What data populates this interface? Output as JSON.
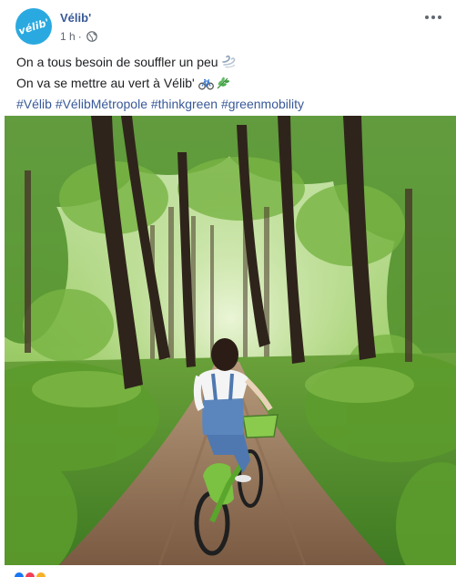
{
  "header": {
    "page_name": "Vélib'",
    "avatar_text": "vélib'",
    "time": "1 h",
    "separator": "·",
    "audience_icon": "globe-icon",
    "more_icon": "more-options-icon"
  },
  "post": {
    "line1": "On a tous besoin de souffler un peu",
    "line1_emoji": "dash-emoji",
    "line2": "On va se mettre au vert à Vélib'",
    "line2_emojis": [
      "bicycle-emoji",
      "herb-emoji"
    ],
    "hashtags": [
      "#Vélib",
      "#VélibMétropole",
      "#thinkgreen",
      "#greenmobility"
    ]
  },
  "photo": {
    "subject": "cyclist-on-green-velib-bike-in-forest"
  },
  "reactions": {
    "icons": [
      "like-reaction-icon",
      "love-reaction-icon",
      "haha-reaction-icon"
    ],
    "colors": [
      "#1877f2",
      "#f33e58",
      "#f7b125"
    ]
  },
  "colors": {
    "link": "#385898",
    "meta": "#606770",
    "brand": "#2aa9e0"
  }
}
